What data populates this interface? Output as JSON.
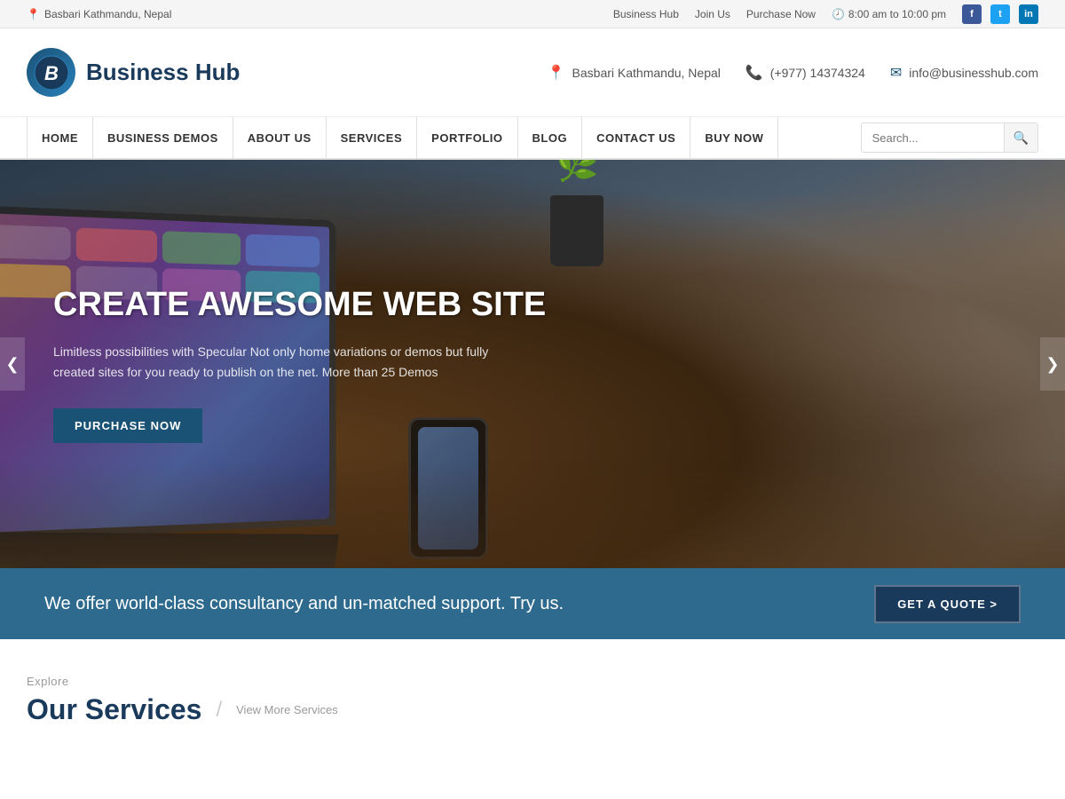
{
  "topbar": {
    "location": "Basbari Kathmandu, Nepal",
    "links": [
      "Business Hub",
      "Join Us",
      "Purchase Now"
    ],
    "time": "8:00 am to 10:00 pm",
    "social": [
      "f",
      "t",
      "in"
    ]
  },
  "header": {
    "logo_letter": "B",
    "logo_text": "Business Hub",
    "contact": {
      "location": "Basbari Kathmandu, Nepal",
      "phone": "(+977) 14374324",
      "email": "info@businesshub.com"
    }
  },
  "nav": {
    "items": [
      "HOME",
      "BUSINESS DEMOS",
      "ABOUT US",
      "SERVICES",
      "PORTFOLIO",
      "BLOG",
      "CONTACT US",
      "BUY NOW"
    ],
    "search_placeholder": "Search..."
  },
  "hero": {
    "title": "CREATE AWESOME WEB SITE",
    "subtitle": "Limitless possibilities with Specular Not only home variations or demos but fully created sites for you ready to publish on the net. More than 25 Demos",
    "button": "PURCHASE NOW",
    "left_arrow": "❮",
    "right_arrow": "❯"
  },
  "cta": {
    "text": "We offer world-class consultancy and un-matched support. Try us.",
    "button": "GET A QUOTE >"
  },
  "services": {
    "explore": "Explore",
    "title": "Our Services",
    "view_more": "View More Services"
  }
}
